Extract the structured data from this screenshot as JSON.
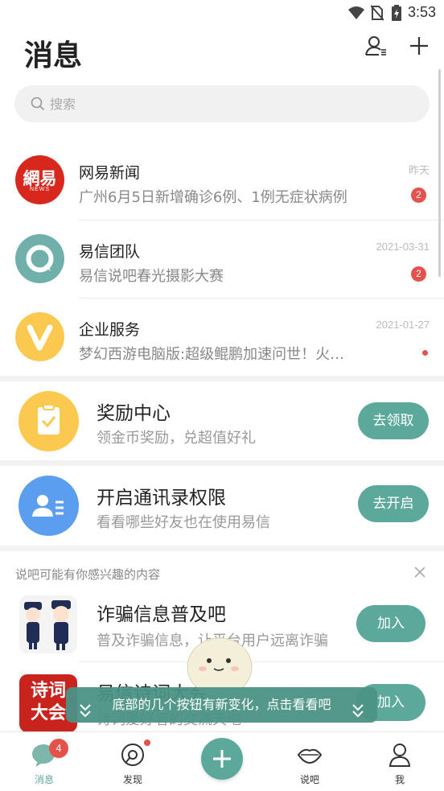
{
  "status_bar": {
    "time": "3:53",
    "icons": [
      "wifi-icon",
      "no-sim-icon",
      "battery-icon"
    ]
  },
  "header": {
    "title": "消息",
    "buttons": [
      "contacts-icon",
      "add-icon"
    ]
  },
  "search": {
    "placeholder": "搜索"
  },
  "conversations": [
    {
      "name": "网易新闻",
      "preview": "广州6月5日新增确诊6例、1例无症状病例",
      "time": "昨天",
      "badge": "2",
      "avatar": "netease-news-logo",
      "avatar_text": "網易",
      "avatar_sub": "NEWS"
    },
    {
      "name": "易信团队",
      "preview": "易信说吧春光摄影大赛",
      "time": "2021-03-31",
      "badge": "2",
      "avatar": "yixin-team-logo"
    },
    {
      "name": "企业服务",
      "preview": "梦幻西游电脑版:超级鲲鹏加速问世！火速来领",
      "time": "2021-01-27",
      "badge": "",
      "avatar": "enterprise-service-logo"
    }
  ],
  "cards": [
    {
      "title": "奖励中心",
      "subtitle": "领金币奖励，兑超值好礼",
      "button": "去领取",
      "icon": "clipboard-check-icon",
      "color": "#fbc94f"
    },
    {
      "title": "开启通讯录权限",
      "subtitle": "看看哪些好友也在使用易信",
      "button": "去开启",
      "icon": "contact-card-icon",
      "color": "#5b9ef0"
    }
  ],
  "recommendations": {
    "title": "说吧可能有你感兴趣的内容",
    "items": [
      {
        "title": "诈骗信息普及吧",
        "subtitle": "普及诈骗信息，让平台用户远离诈骗",
        "button": "加入",
        "icon": "police-cartoon-icon"
      },
      {
        "title": "易信诗词大会",
        "subtitle": "诗词爱好者的交流天地",
        "button": "加入",
        "icon": "poetry-contest-icon",
        "icon_text": "诗词大会"
      }
    ]
  },
  "toast": {
    "text": "底部的几个按钮有新变化，点击看看吧"
  },
  "bottom_nav": [
    {
      "label": "消息",
      "icon": "message-bubble-icon",
      "badge": "4",
      "active": true
    },
    {
      "label": "发现",
      "icon": "discover-icon",
      "dot": true
    },
    {
      "label": "",
      "icon": "plus-icon"
    },
    {
      "label": "说吧",
      "icon": "lips-icon"
    },
    {
      "label": "我",
      "icon": "person-icon"
    }
  ],
  "colors": {
    "accent": "#5ca99c",
    "badge": "#e5524b",
    "netease_red": "#d8281d"
  }
}
